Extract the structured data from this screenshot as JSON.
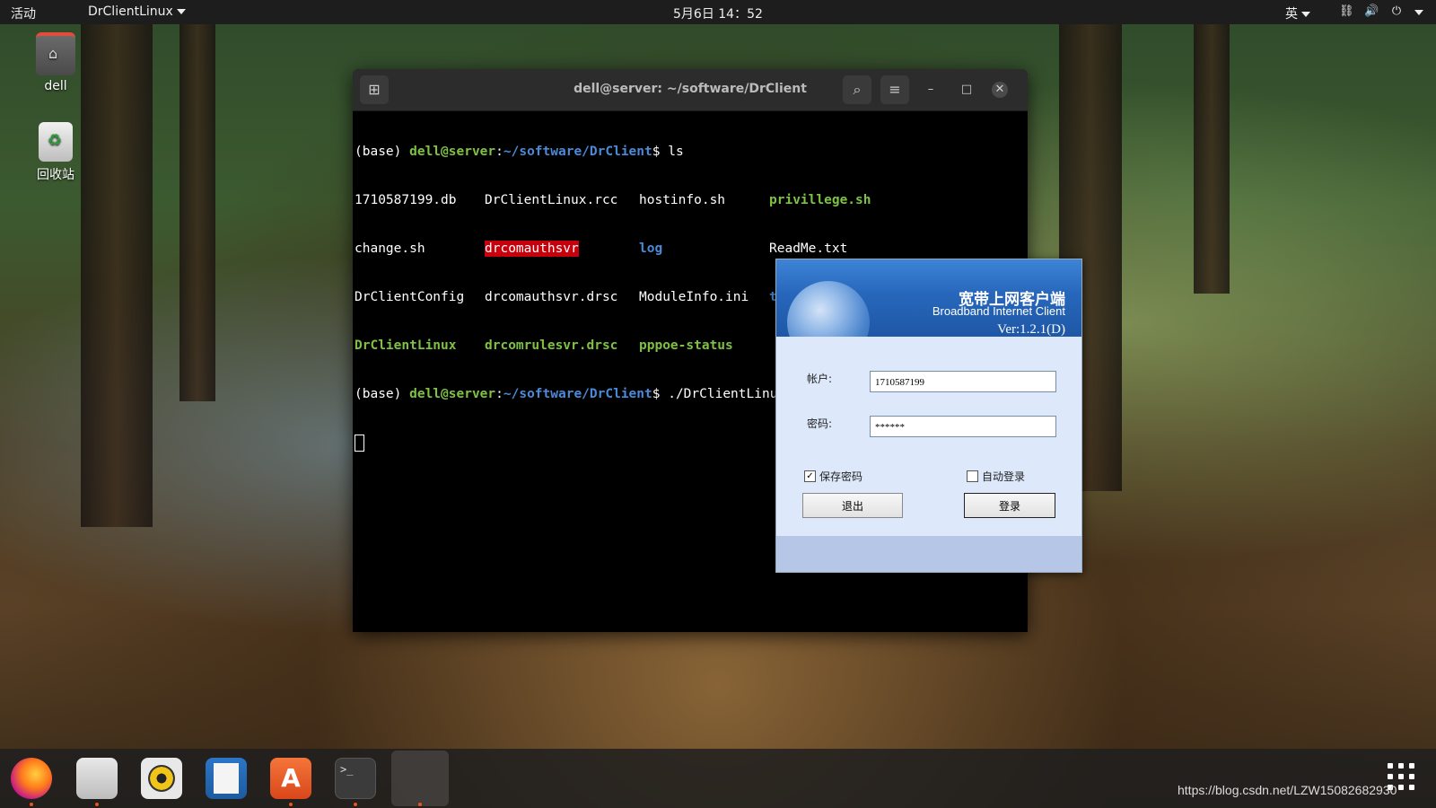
{
  "topbar": {
    "activities": "活动",
    "app_menu": "DrClientLinux",
    "clock": "5月6日 14：52",
    "input_method": "英"
  },
  "desktop": {
    "home_label": "dell",
    "trash_label": "回收站"
  },
  "terminal": {
    "title": "dell@server: ~/software/DrClient",
    "prompt_prefix": "(base) ",
    "prompt_user": "dell@server",
    "prompt_colon": ":",
    "prompt_path": "~/software/DrClient",
    "prompt_dollar": "$ ",
    "cmd1": "ls",
    "cmd2": "./DrClientLinux",
    "files": {
      "r1c1": "1710587199.db",
      "r1c2": "DrClientLinux.rcc",
      "r1c3": "hostinfo.sh",
      "r1c4": "privillege.sh",
      "r2c1": "change.sh",
      "r2c2": "drcomauthsvr",
      "r2c3": "log",
      "r2c4": "ReadMe.txt",
      "r3c1": "DrClientConfig",
      "r3c2": "drcomauthsvr.drsc",
      "r3c3": "ModuleInfo.ini",
      "r3c4": "translator",
      "r4c1": "DrClientLinux",
      "r4c2": "drcomrulesvr.drsc",
      "r4c3": "pppoe-status"
    }
  },
  "client": {
    "brand_cn": "宽带上网客户端",
    "brand_en": "Broadband Internet Client",
    "version": "Ver:1.2.1(D)",
    "account_label": "帐户:",
    "account_value": "1710587199",
    "password_label": "密码:",
    "password_value": "******",
    "save_password_label": "保存密码",
    "save_password_checked": true,
    "auto_login_label": "自动登录",
    "auto_login_checked": false,
    "exit_button": "退出",
    "login_button": "登录"
  },
  "dock": {
    "apps": [
      "firefox-icon",
      "files-icon",
      "rhythmbox-icon",
      "libreoffice-writer-icon",
      "software-center-icon",
      "terminal-icon",
      "drclient-icon"
    ]
  },
  "watermark": "https://blog.csdn.net/LZW15082682930"
}
